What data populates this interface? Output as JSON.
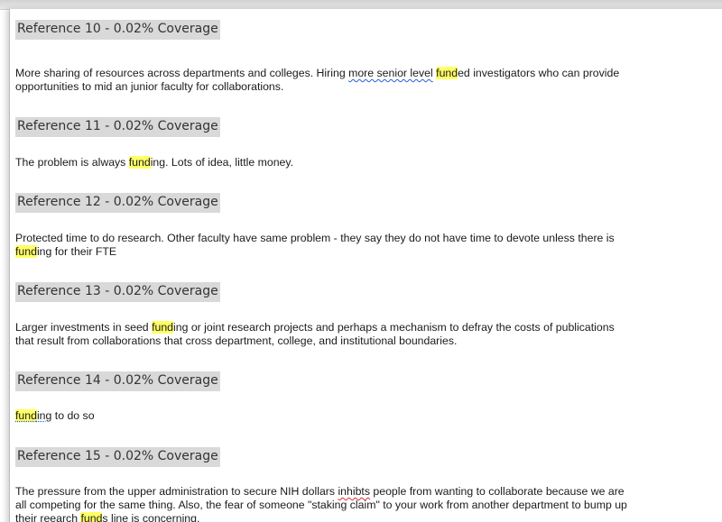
{
  "references": [
    {
      "heading": "Reference 10 - 0.02% Coverage",
      "line1": {
        "a": "More sharing of resources across departments and colleges. Hiring ",
        "b": "more senior level",
        "c": " ",
        "d": "fund",
        "e": "ed investigators who can provide"
      },
      "line2": "opportunities to mid an junior faculty for collaborations."
    },
    {
      "heading": "Reference 11 - 0.02% Coverage",
      "line1": {
        "a": "The problem is always ",
        "b": "fund",
        "c": "ing.  Lots of idea, little money."
      }
    },
    {
      "heading": "Reference 12 - 0.02% Coverage",
      "line1": "Protected time to do research. Other faculty have same problem - they say they do not have time to devote unless there is",
      "line2": {
        "a": "fund",
        "b": "ing for their FTE"
      }
    },
    {
      "heading": "Reference 13 - 0.02% Coverage",
      "line1": {
        "a": "Larger investments in seed ",
        "b": "fund",
        "c": "ing or joint research projects and perhaps a mechanism to defray the costs of publications"
      },
      "line2": "that result from collaborations that cross department, college, and institutional boundaries."
    },
    {
      "heading": "Reference 14 - 0.02% Coverage",
      "line1": {
        "a": "fund",
        "b": "ing",
        "c": " to do so"
      }
    },
    {
      "heading": "Reference 15 - 0.02% Coverage",
      "line1": {
        "a": "The pressure from the upper administration to secure NIH dollars ",
        "b": "inhibts",
        "c": " people from wanting to collaborate because we are"
      },
      "line2": "all competing for the same thing. Also, the fear of someone \"staking claim\" to your work from another department to bump up",
      "line3": {
        "a": "their ",
        "b": "reearch",
        "c": " ",
        "d": "fund",
        "e": "s line is ",
        "f": " concerning",
        "g": "."
      }
    }
  ]
}
